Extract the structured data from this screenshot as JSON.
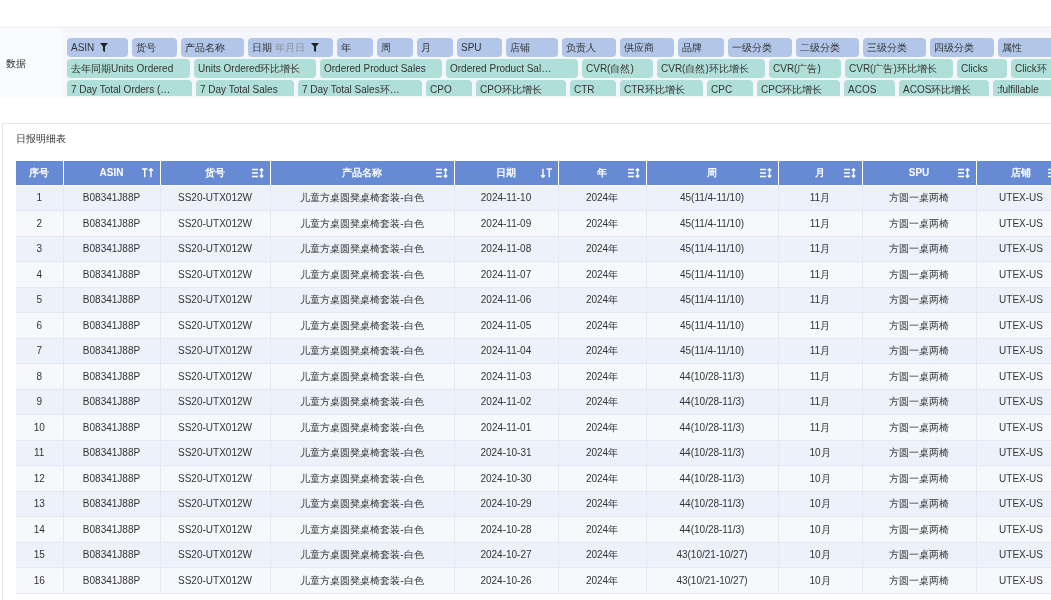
{
  "filter_panel": {
    "label": "数据",
    "field_rows": [
      {
        "kind": "dimension",
        "fields": [
          {
            "label": "ASIN",
            "filtered": true
          },
          {
            "label": "货号",
            "filtered": false
          },
          {
            "label": "产品名称",
            "filtered": false
          },
          {
            "label": "日期",
            "granularity": "年月日",
            "filtered": true
          },
          {
            "label": "年",
            "filtered": false
          },
          {
            "label": "周",
            "filtered": false
          },
          {
            "label": "月",
            "filtered": false
          },
          {
            "label": "SPU",
            "filtered": false
          },
          {
            "label": "店铺",
            "filtered": false
          },
          {
            "label": "负责人",
            "filtered": false
          },
          {
            "label": "供应商",
            "filtered": false
          },
          {
            "label": "品牌",
            "filtered": false
          },
          {
            "label": "一级分类",
            "filtered": false
          },
          {
            "label": "二级分类",
            "filtered": false
          },
          {
            "label": "三级分类",
            "filtered": false
          },
          {
            "label": "四级分类",
            "filtered": false
          },
          {
            "label": "属性",
            "filtered": false
          }
        ]
      },
      {
        "kind": "measure",
        "fields": [
          {
            "label": "去年同期Units Ordered"
          },
          {
            "label": "Units Ordered环比增长"
          },
          {
            "label": "Ordered Product Sales"
          },
          {
            "label": "Ordered Product Sal…"
          },
          {
            "label": "CVR(自然)"
          },
          {
            "label": "CVR(自然)环比增长"
          },
          {
            "label": "CVR(广告)"
          },
          {
            "label": "CVR(广告)环比增长"
          },
          {
            "label": "Clicks"
          },
          {
            "label": "Click环"
          }
        ]
      },
      {
        "kind": "measure",
        "fields": [
          {
            "label": "7 Day Total Orders (…"
          },
          {
            "label": "7 Day Total Sales"
          },
          {
            "label": "7 Day Total Sales环…"
          },
          {
            "label": "CPO"
          },
          {
            "label": "CPO环比增长"
          },
          {
            "label": "CTR"
          },
          {
            "label": "CTR环比增长"
          },
          {
            "label": "CPC"
          },
          {
            "label": "CPC环比增长"
          },
          {
            "label": "ACOS"
          },
          {
            "label": "ACOS环比增长"
          },
          {
            "label": ":fulfillable"
          }
        ]
      }
    ]
  },
  "table": {
    "title": "日报明细表",
    "columns": [
      {
        "label": "序号",
        "kind": "plain"
      },
      {
        "label": "ASIN",
        "kind": "ascending"
      },
      {
        "label": "货号",
        "kind": "sortable"
      },
      {
        "label": "产品名称",
        "kind": "sortable"
      },
      {
        "label": "日期",
        "kind": "descending"
      },
      {
        "label": "年",
        "kind": "sortable"
      },
      {
        "label": "周",
        "kind": "sortable"
      },
      {
        "label": "月",
        "kind": "sortable"
      },
      {
        "label": "SPU",
        "kind": "sortable"
      },
      {
        "label": "店铺",
        "kind": "sortable"
      }
    ],
    "rows": [
      [
        "1",
        "B08341J88P",
        "SS20-UTX012W",
        "儿童方桌圆凳桌椅套装-白色",
        "2024-11-10",
        "2024年",
        "45(11/4-11/10)",
        "11月",
        "方圆一桌两椅",
        "UTEX-US"
      ],
      [
        "2",
        "B08341J88P",
        "SS20-UTX012W",
        "儿童方桌圆凳桌椅套装-白色",
        "2024-11-09",
        "2024年",
        "45(11/4-11/10)",
        "11月",
        "方圆一桌两椅",
        "UTEX-US"
      ],
      [
        "3",
        "B08341J88P",
        "SS20-UTX012W",
        "儿童方桌圆凳桌椅套装-白色",
        "2024-11-08",
        "2024年",
        "45(11/4-11/10)",
        "11月",
        "方圆一桌两椅",
        "UTEX-US"
      ],
      [
        "4",
        "B08341J88P",
        "SS20-UTX012W",
        "儿童方桌圆凳桌椅套装-白色",
        "2024-11-07",
        "2024年",
        "45(11/4-11/10)",
        "11月",
        "方圆一桌两椅",
        "UTEX-US"
      ],
      [
        "5",
        "B08341J88P",
        "SS20-UTX012W",
        "儿童方桌圆凳桌椅套装-白色",
        "2024-11-06",
        "2024年",
        "45(11/4-11/10)",
        "11月",
        "方圆一桌两椅",
        "UTEX-US"
      ],
      [
        "6",
        "B08341J88P",
        "SS20-UTX012W",
        "儿童方桌圆凳桌椅套装-白色",
        "2024-11-05",
        "2024年",
        "45(11/4-11/10)",
        "11月",
        "方圆一桌两椅",
        "UTEX-US"
      ],
      [
        "7",
        "B08341J88P",
        "SS20-UTX012W",
        "儿童方桌圆凳桌椅套装-白色",
        "2024-11-04",
        "2024年",
        "45(11/4-11/10)",
        "11月",
        "方圆一桌两椅",
        "UTEX-US"
      ],
      [
        "8",
        "B08341J88P",
        "SS20-UTX012W",
        "儿童方桌圆凳桌椅套装-白色",
        "2024-11-03",
        "2024年",
        "44(10/28-11/3)",
        "11月",
        "方圆一桌两椅",
        "UTEX-US"
      ],
      [
        "9",
        "B08341J88P",
        "SS20-UTX012W",
        "儿童方桌圆凳桌椅套装-白色",
        "2024-11-02",
        "2024年",
        "44(10/28-11/3)",
        "11月",
        "方圆一桌两椅",
        "UTEX-US"
      ],
      [
        "10",
        "B08341J88P",
        "SS20-UTX012W",
        "儿童方桌圆凳桌椅套装-白色",
        "2024-11-01",
        "2024年",
        "44(10/28-11/3)",
        "11月",
        "方圆一桌两椅",
        "UTEX-US"
      ],
      [
        "11",
        "B08341J88P",
        "SS20-UTX012W",
        "儿童方桌圆凳桌椅套装-白色",
        "2024-10-31",
        "2024年",
        "44(10/28-11/3)",
        "10月",
        "方圆一桌两椅",
        "UTEX-US"
      ],
      [
        "12",
        "B08341J88P",
        "SS20-UTX012W",
        "儿童方桌圆凳桌椅套装-白色",
        "2024-10-30",
        "2024年",
        "44(10/28-11/3)",
        "10月",
        "方圆一桌两椅",
        "UTEX-US"
      ],
      [
        "13",
        "B08341J88P",
        "SS20-UTX012W",
        "儿童方桌圆凳桌椅套装-白色",
        "2024-10-29",
        "2024年",
        "44(10/28-11/3)",
        "10月",
        "方圆一桌两椅",
        "UTEX-US"
      ],
      [
        "14",
        "B08341J88P",
        "SS20-UTX012W",
        "儿童方桌圆凳桌椅套装-白色",
        "2024-10-28",
        "2024年",
        "44(10/28-11/3)",
        "10月",
        "方圆一桌两椅",
        "UTEX-US"
      ],
      [
        "15",
        "B08341J88P",
        "SS20-UTX012W",
        "儿童方桌圆凳桌椅套装-白色",
        "2024-10-27",
        "2024年",
        "43(10/21-10/27)",
        "10月",
        "方圆一桌两椅",
        "UTEX-US"
      ],
      [
        "16",
        "B08341J88P",
        "SS20-UTX012W",
        "儿童方桌圆凳桌椅套装-白色",
        "2024-10-26",
        "2024年",
        "43(10/21-10/27)",
        "10月",
        "方圆一桌两椅",
        "UTEX-US"
      ]
    ]
  }
}
